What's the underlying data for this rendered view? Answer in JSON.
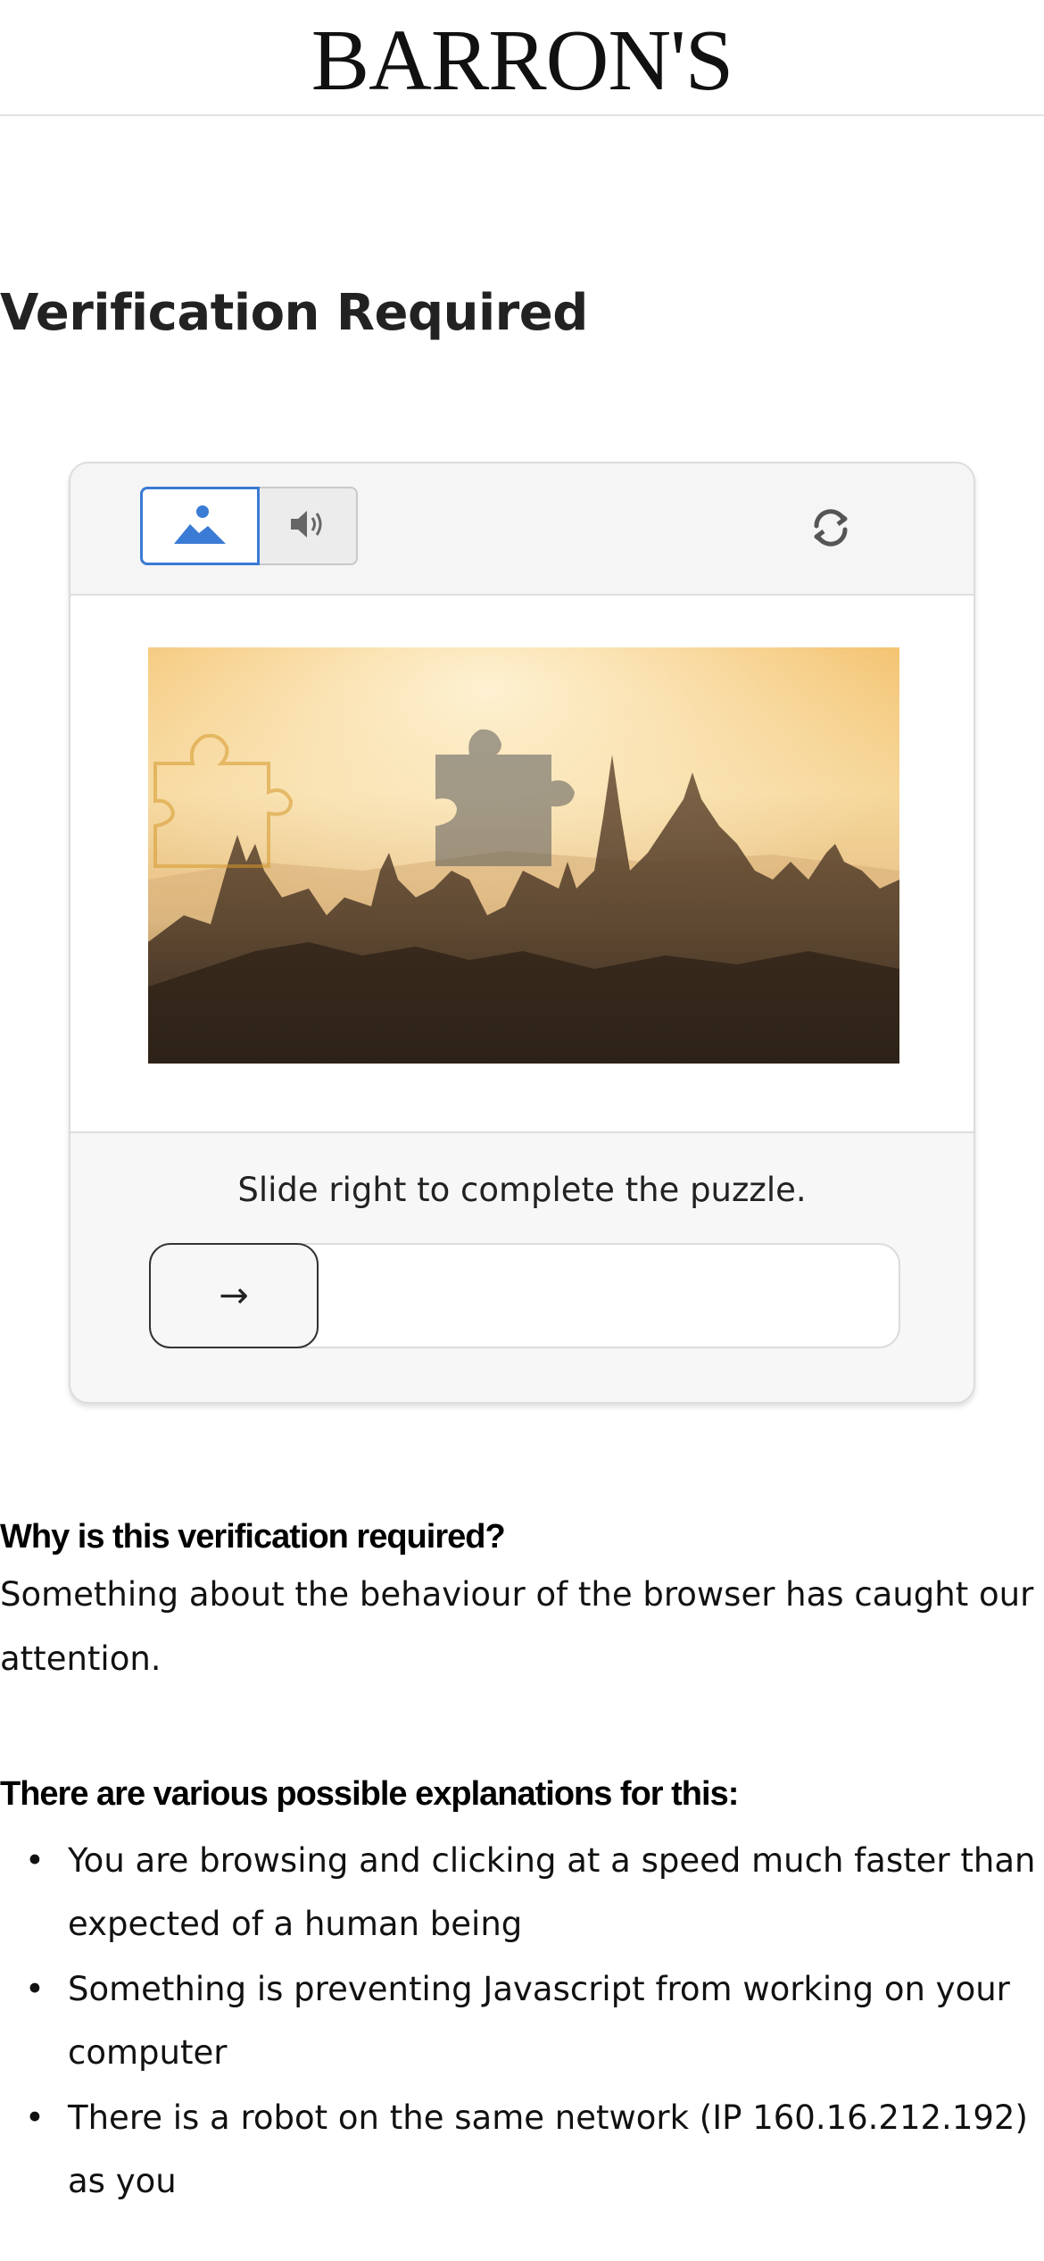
{
  "header": {
    "logo": "BARRON'S"
  },
  "page": {
    "title": "Verification Required"
  },
  "captcha": {
    "modes": [
      {
        "icon": "image-icon",
        "selected": true
      },
      {
        "icon": "speaker-icon",
        "selected": false
      }
    ],
    "refresh_icon": "refresh-icon",
    "instruction": "Slide right to complete the puzzle.",
    "slider_icon": "arrow-right-icon",
    "slider_arrow": "→",
    "accent_color": "#3a7bd5"
  },
  "info": {
    "why_heading": "Why is this verification required?",
    "why_text": "Something about the behaviour of the browser has caught our attention.",
    "explanations_heading": "There are various possible explanations for this:",
    "explanations": [
      "You are browsing and clicking at a speed much faster than expected of a human being",
      "Something is preventing Javascript from working on your computer",
      "There is a robot on the same network (IP 160.16.212.192) as you"
    ]
  }
}
